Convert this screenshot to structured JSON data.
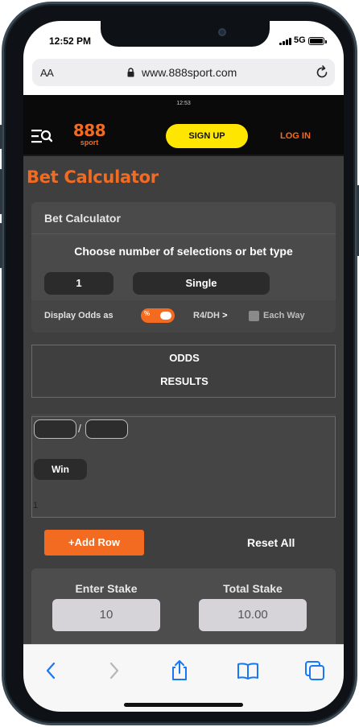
{
  "status_bar": {
    "time": "12:52 PM",
    "network": "5G"
  },
  "browser": {
    "text_size_label": "AA",
    "url": "www.888sport.com"
  },
  "page": {
    "mini_clock": "12:53",
    "header": {
      "logo_main": "888",
      "logo_sub": "sport",
      "signup_label": "SIGN UP",
      "login_label": "LOG IN"
    },
    "title": "Bet Calculator",
    "calculator": {
      "panel_title": "Bet Calculator",
      "instruction": "Choose number of selections or bet type",
      "selections_value": "1",
      "bet_type_value": "Single",
      "display_odds_label": "Display Odds as",
      "odds_toggle_symbol": "%",
      "r4dh_label": "R4/DH",
      "r4dh_arrow": ">",
      "each_way_label": "Each Way"
    },
    "results": {
      "odds_label": "ODDS",
      "results_label": "RESULTS"
    },
    "row": {
      "separator": "/",
      "outcome_label": "Win",
      "row_number": "1"
    },
    "actions": {
      "add_row_label": "+Add Row",
      "reset_all_label": "Reset All"
    },
    "stake": {
      "enter_stake_label": "Enter Stake",
      "enter_stake_value": "10",
      "total_stake_label": "Total Stake",
      "total_stake_value": "10.00"
    }
  },
  "colors": {
    "brand_orange": "#f26b21",
    "signup_yellow": "#ffe600",
    "panel_grey": "#4a4a4a"
  }
}
